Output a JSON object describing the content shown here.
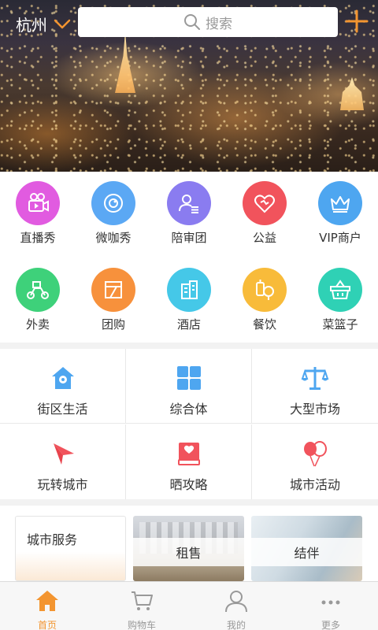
{
  "header": {
    "city": "杭州",
    "search_placeholder": "搜索"
  },
  "grid": [
    {
      "label": "直播秀",
      "color": "#e15be0",
      "icon": "video-camera-icon"
    },
    {
      "label": "微咖秀",
      "color": "#5ba8f4",
      "icon": "camera-lens-icon"
    },
    {
      "label": "陪审团",
      "color": "#8a7cf0",
      "icon": "user-list-icon"
    },
    {
      "label": "公益",
      "color": "#f1535c",
      "icon": "heart-icon"
    },
    {
      "label": "VIP商户",
      "color": "#4ea6f0",
      "icon": "crown-icon"
    },
    {
      "label": "外卖",
      "color": "#3ed17a",
      "icon": "scooter-icon"
    },
    {
      "label": "团购",
      "color": "#f7913c",
      "icon": "coupon-icon"
    },
    {
      "label": "酒店",
      "color": "#45c8e8",
      "icon": "building-icon"
    },
    {
      "label": "餐饮",
      "color": "#f8bb3a",
      "icon": "food-icon"
    },
    {
      "label": "菜篮子",
      "color": "#2fd1b5",
      "icon": "basket-icon"
    }
  ],
  "categories": [
    {
      "label": "街区生活",
      "icon": "home-location-icon"
    },
    {
      "label": "综合体",
      "icon": "grid-blocks-icon"
    },
    {
      "label": "大型市场",
      "icon": "scale-icon"
    },
    {
      "label": "玩转城市",
      "icon": "paper-plane-icon"
    },
    {
      "label": "晒攻略",
      "icon": "book-icon"
    },
    {
      "label": "城市活动",
      "icon": "balloons-icon"
    }
  ],
  "cards": {
    "service": "城市服务",
    "rent": "租售",
    "partner": "结伴"
  },
  "nav": {
    "home": "首页",
    "cart": "购物车",
    "mine": "我的",
    "more": "更多",
    "active_color": "#f39530"
  }
}
